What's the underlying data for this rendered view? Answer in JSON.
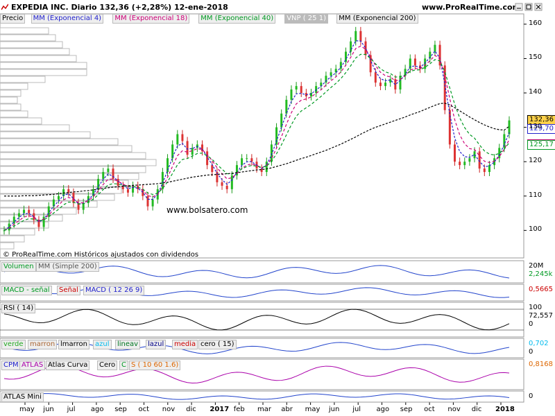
{
  "header": {
    "title": "EXPEDIA INC.   Diario   132,36 (+2,28%)   12-ene-2018",
    "site": "www.ProRealTime.com"
  },
  "price_legend": [
    {
      "text": "Precio",
      "color": "#000000"
    },
    {
      "text": "MM (Exponencial 4)",
      "color": "#2222cc"
    },
    {
      "text": "MM (Exponencial 18)",
      "color": "#cc0077"
    },
    {
      "text": "MM (Exponencial 40)",
      "color": "#009922"
    },
    {
      "text": "VNP ( 25 1)",
      "color": "#ffffff"
    },
    {
      "text": "MM (Exponencial 200)",
      "color": "#000000"
    }
  ],
  "price_tags": [
    {
      "text": "132,36",
      "color": "#000000",
      "bg": "#ffd24a"
    },
    {
      "text": "129,70",
      "color": "#2222cc",
      "bg": "#ffffff"
    },
    {
      "text": "125,22",
      "color": "#cc0077",
      "bg": "#ffffff"
    },
    {
      "text": "125,17",
      "color": "#009922",
      "bg": "#ffffff"
    }
  ],
  "watermark": "www.bolsatero.com",
  "footer": "© ProRealTime.com  Históricos ajustados con dividendos",
  "indicator_panels": [
    {
      "legend": [
        {
          "text": "Volumen",
          "color": "#009922"
        },
        {
          "text": "MM (Simple 200)",
          "color": "#555555"
        }
      ],
      "values": [
        {
          "text": "20M",
          "color": "#000000"
        },
        {
          "text": "2,245k",
          "color": "#009922"
        }
      ]
    },
    {
      "legend": [
        {
          "text": "MACD - señal",
          "color": "#009922"
        },
        {
          "text": "Señal",
          "color": "#cc0000"
        },
        {
          "text": "MACD ( 12 26 9)",
          "color": "#2222cc"
        }
      ],
      "values": [
        {
          "text": "0,5665",
          "color": "#cc0000"
        }
      ]
    },
    {
      "legend": [
        {
          "text": "RSI ( 14)",
          "color": "#000000"
        }
      ],
      "values": [
        {
          "text": "100",
          "color": "#000000"
        },
        {
          "text": "72,557",
          "color": "#000000"
        },
        {
          "text": "0",
          "color": "#000000"
        }
      ]
    },
    {
      "legend": [
        {
          "text": "verde",
          "color": "#22aa22"
        },
        {
          "text": "marron",
          "color": "#aa6633"
        },
        {
          "text": "lmarron",
          "color": "#000000"
        },
        {
          "text": "azul",
          "color": "#00bbee"
        },
        {
          "text": "lineav",
          "color": "#007722"
        },
        {
          "text": "lazul",
          "color": "#000088"
        },
        {
          "text": "media",
          "color": "#cc0000"
        },
        {
          "text": "cero ( 15)",
          "color": "#000000"
        }
      ],
      "values": [
        {
          "text": "0,702",
          "color": "#00bbee"
        },
        {
          "text": "0",
          "color": "#000000"
        }
      ]
    },
    {
      "legend": [
        {
          "text": "CPM",
          "color": "#2222cc"
        },
        {
          "text": "ATLAS",
          "color": "#aa00aa"
        },
        {
          "text": "Atlas Curva",
          "color": "#000000"
        },
        {
          "text": "Cero",
          "color": "#000000"
        },
        {
          "text": "C",
          "color": "#009922"
        },
        {
          "text": "S ( 10 60 1.6)",
          "color": "#dd6600"
        }
      ],
      "values": [
        {
          "text": "0,8168",
          "color": "#dd6600"
        }
      ]
    },
    {
      "legend": [
        {
          "text": "ATLAS Mini",
          "color": "#000000"
        }
      ],
      "values": [
        {
          "text": "0",
          "color": "#000000"
        }
      ]
    }
  ],
  "chart_data": {
    "type": "line",
    "ylim": [
      92,
      163
    ],
    "yticks": [
      100,
      110,
      120,
      130,
      140,
      150,
      160
    ],
    "x_month_labels": [
      "may",
      "jun",
      "jul",
      "ago",
      "sep",
      "oct",
      "nov",
      "dic",
      "2017",
      "feb",
      "mar",
      "abr",
      "may",
      "jun",
      "jul",
      "ago",
      "sep",
      "oct",
      "nov",
      "dic",
      "2018"
    ],
    "price_series": {
      "name": "Precio",
      "values": [
        100,
        102,
        104,
        105,
        106,
        105,
        103,
        101,
        104,
        107,
        109,
        110,
        112,
        111,
        108,
        106,
        108,
        110,
        112,
        115,
        117,
        118,
        115,
        113,
        112,
        111,
        113,
        112,
        110,
        107,
        109,
        112,
        117,
        121,
        125,
        128,
        126,
        122,
        124,
        125,
        123,
        119,
        117,
        114,
        113,
        112,
        116,
        119,
        121,
        121,
        120,
        118,
        117,
        120,
        125,
        130,
        134,
        138,
        141,
        142,
        140,
        139,
        140,
        142,
        143,
        145,
        146,
        147,
        149,
        152,
        155,
        158,
        155,
        151,
        146,
        143,
        142,
        143,
        144,
        141,
        145,
        147,
        150,
        148,
        147,
        150,
        152,
        154,
        148,
        135,
        125,
        120,
        119,
        120,
        121,
        123,
        118,
        117,
        119,
        121,
        124,
        128,
        132
      ]
    },
    "ema200_series": {
      "name": "MM (Exponencial 200)",
      "values": [
        110.0,
        110.0,
        110.0,
        110.0,
        110.1,
        110.1,
        110.1,
        110.2,
        110.3,
        110.4,
        110.5,
        110.7,
        110.9,
        111.0,
        111.2,
        111.3,
        111.5,
        111.6,
        111.8,
        112.0,
        112.2,
        112.4,
        112.6,
        112.7,
        112.9,
        113.0,
        113.1,
        113.2,
        113.3,
        113.4,
        113.5,
        113.6,
        113.8,
        114.0,
        114.3,
        114.6,
        114.9,
        115.2,
        115.5,
        115.7,
        115.9,
        116.1,
        116.2,
        116.3,
        116.4,
        116.5,
        116.6,
        116.8,
        117.0,
        117.2,
        117.4,
        117.6,
        117.7,
        117.9,
        118.2,
        118.6,
        119.0,
        119.4,
        119.9,
        120.4,
        120.9,
        121.3,
        121.8,
        122.3,
        122.8,
        123.3,
        123.9,
        124.5,
        125.1,
        125.8,
        126.5,
        127.2,
        128.0,
        128.7,
        129.4,
        130.0,
        130.5,
        131.0,
        131.5,
        132.0,
        132.5,
        133.0,
        133.6,
        134.1,
        134.6,
        135.2,
        135.8,
        136.4,
        136.9,
        137.0,
        136.5,
        135.7,
        134.8,
        133.9,
        133.0,
        132.2,
        131.4,
        130.7,
        130.1,
        129.6,
        129.3,
        129.2,
        130.3
      ]
    }
  }
}
